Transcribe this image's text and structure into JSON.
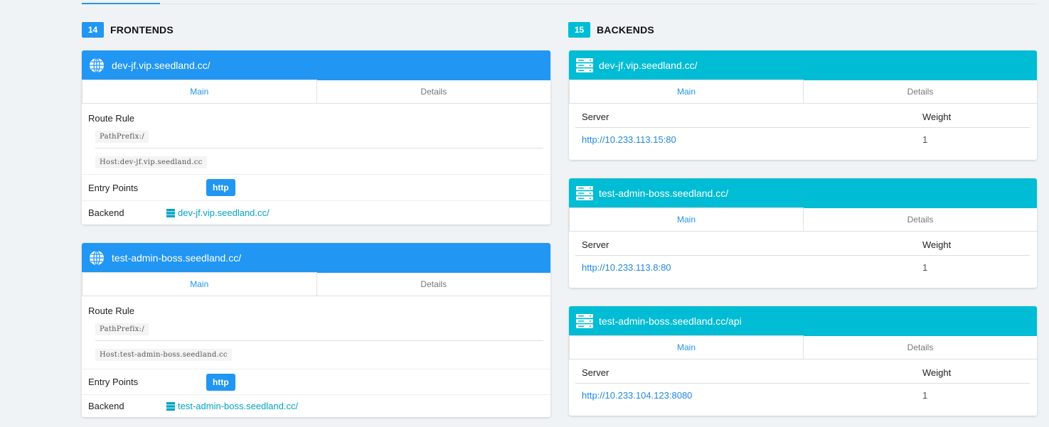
{
  "frontends": {
    "count": "14",
    "title": "FRONTENDS",
    "items": [
      {
        "name": "dev-jf.vip.seedland.cc/",
        "tabs": [
          "Main",
          "Details"
        ],
        "route_rule_label": "Route Rule",
        "rules": [
          "PathPrefix:/",
          "Host:dev-jf.vip.seedland.cc"
        ],
        "entry_points_label": "Entry Points",
        "entry_point": "http",
        "backend_label": "Backend",
        "backend": "dev-jf.vip.seedland.cc/"
      },
      {
        "name": "test-admin-boss.seedland.cc/",
        "tabs": [
          "Main",
          "Details"
        ],
        "route_rule_label": "Route Rule",
        "rules": [
          "PathPrefix:/",
          "Host:test-admin-boss.seedland.cc"
        ],
        "entry_points_label": "Entry Points",
        "entry_point": "http",
        "backend_label": "Backend",
        "backend": "test-admin-boss.seedland.cc/"
      }
    ]
  },
  "backends": {
    "count": "15",
    "title": "BACKENDS",
    "items": [
      {
        "name": "dev-jf.vip.seedland.cc/",
        "tabs": [
          "Main",
          "Details"
        ],
        "columns": [
          "Server",
          "Weight"
        ],
        "server": "http://10.233.113.15:80",
        "weight": "1"
      },
      {
        "name": "test-admin-boss.seedland.cc/",
        "tabs": [
          "Main",
          "Details"
        ],
        "columns": [
          "Server",
          "Weight"
        ],
        "server": "http://10.233.113.8:80",
        "weight": "1"
      },
      {
        "name": "test-admin-boss.seedland.cc/api",
        "tabs": [
          "Main",
          "Details"
        ],
        "columns": [
          "Server",
          "Weight"
        ],
        "server": "http://10.233.104.123:8080",
        "weight": "1"
      }
    ]
  },
  "colors": {
    "frontend_header": "#2196f3",
    "backend_header": "#00bcd4",
    "link": "#1e88e5"
  },
  "icons": {
    "frontend": "globe-icon",
    "backend": "server-icon"
  }
}
